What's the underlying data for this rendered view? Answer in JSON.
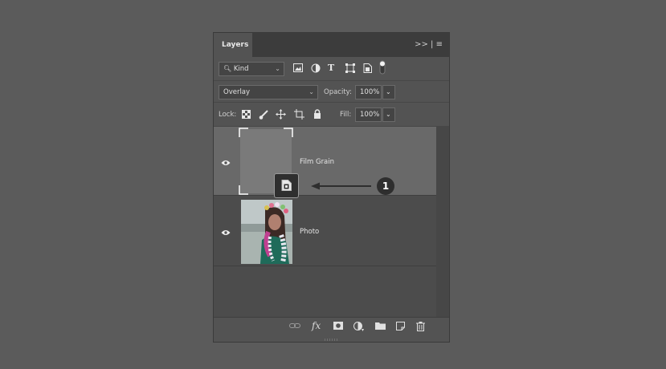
{
  "panel": {
    "tab_label": "Layers",
    "tab_controls": ">> | ≡"
  },
  "filter": {
    "kind_label": "Kind",
    "icons": [
      "image-filter-icon",
      "adjustment-filter-icon",
      "type-filter-icon",
      "shape-filter-icon",
      "smart-object-filter-icon",
      "filter-toggle-icon"
    ]
  },
  "blend": {
    "mode": "Overlay",
    "opacity_label": "Opacity:",
    "opacity_value": "100%"
  },
  "lock": {
    "label": "Lock:",
    "fill_label": "Fill:",
    "fill_value": "100%",
    "icons": [
      "lock-transparent-icon",
      "lock-image-icon",
      "lock-position-icon",
      "lock-artboard-icon",
      "lock-all-icon"
    ]
  },
  "layers": [
    {
      "name": "Film Grain",
      "visible": true,
      "selected": true,
      "thumb_color": "#7a7a7a",
      "badge": "smart-object-badge-icon"
    },
    {
      "name": "Photo",
      "visible": true,
      "selected": false
    }
  ],
  "callout": {
    "number": "1"
  },
  "footer": {
    "icons": [
      "link-icon",
      "fx-icon",
      "mask-icon",
      "adjustment-icon",
      "group-folder-icon",
      "new-layer-icon",
      "trash-icon"
    ],
    "fx_label": "fx"
  },
  "colors": {
    "background": "#5b5b5b",
    "panel": "#535353",
    "selected_row": "#696969",
    "callout_fill": "#2e2e2e"
  }
}
